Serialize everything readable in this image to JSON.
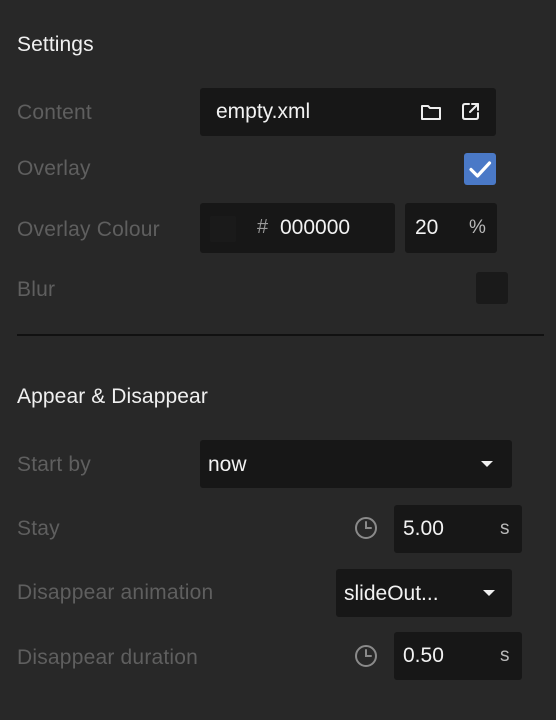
{
  "settings": {
    "title": "Settings",
    "content": {
      "label": "Content",
      "value": "empty.xml",
      "folder_icon": "folder-icon",
      "open_external_icon": "external-link-icon"
    },
    "overlay": {
      "label": "Overlay",
      "checked": true
    },
    "overlay_colour": {
      "label": "Overlay Colour",
      "swatch_color": "#1a1a1a",
      "hash": "#",
      "hex": "000000",
      "opacity": "20",
      "opacity_unit": "%"
    },
    "blur": {
      "label": "Blur",
      "checked": false
    }
  },
  "appear": {
    "title": "Appear & Disappear",
    "start_by": {
      "label": "Start by",
      "value": "now"
    },
    "stay": {
      "label": "Stay",
      "value": "5.00",
      "unit": "s"
    },
    "disappear_animation": {
      "label": "Disappear animation",
      "value": "slideOut..."
    },
    "disappear_duration": {
      "label": "Disappear duration",
      "value": "0.50",
      "unit": "s"
    }
  },
  "colors": {
    "background": "#282828",
    "field": "#171717",
    "accent": "#4a79c7",
    "label": "#5f5f5f"
  }
}
